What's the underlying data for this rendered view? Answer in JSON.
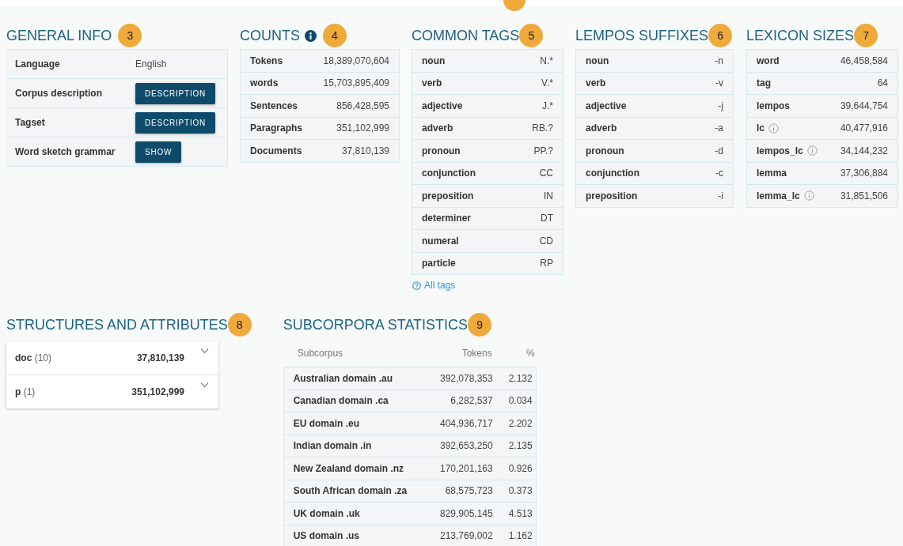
{
  "general_info": {
    "title": "GENERAL INFO",
    "badge": "3",
    "rows": [
      {
        "label": "Language",
        "kind": "text",
        "value": "English"
      },
      {
        "label": "Corpus description",
        "kind": "button",
        "value": "DESCRIPTION"
      },
      {
        "label": "Tagset",
        "kind": "button",
        "value": "DESCRIPTION"
      },
      {
        "label": "Word sketch grammar",
        "kind": "button",
        "value": "SHOW"
      }
    ]
  },
  "counts": {
    "title": "COUNTS",
    "badge": "4",
    "info": true,
    "rows": [
      {
        "label": "Tokens",
        "value": "18,389,070,604"
      },
      {
        "label": "words",
        "value": "15,703,895,409"
      },
      {
        "label": "Sentences",
        "value": "856,428,595"
      },
      {
        "label": "Paragraphs",
        "value": "351,102,999"
      },
      {
        "label": "Documents",
        "value": "37,810,139"
      }
    ]
  },
  "common_tags": {
    "title": "COMMON TAGS",
    "badge": "5",
    "rows": [
      {
        "label": "noun",
        "value": "N.*"
      },
      {
        "label": "verb",
        "value": "V.*"
      },
      {
        "label": "adjective",
        "value": "J.*"
      },
      {
        "label": "adverb",
        "value": "RB.?"
      },
      {
        "label": "pronoun",
        "value": "PP.?"
      },
      {
        "label": "conjunction",
        "value": "CC"
      },
      {
        "label": "preposition",
        "value": "IN"
      },
      {
        "label": "determiner",
        "value": "DT"
      },
      {
        "label": "numeral",
        "value": "CD"
      },
      {
        "label": "particle",
        "value": "RP"
      }
    ],
    "link": "All tags"
  },
  "lempos_suffixes": {
    "title": "LEMPOS SUFFIXES",
    "badge": "6",
    "rows": [
      {
        "label": "noun",
        "value": "-n"
      },
      {
        "label": "verb",
        "value": "-v"
      },
      {
        "label": "adjective",
        "value": "-j"
      },
      {
        "label": "adverb",
        "value": "-a"
      },
      {
        "label": "pronoun",
        "value": "-d"
      },
      {
        "label": "conjunction",
        "value": "-c"
      },
      {
        "label": "preposition",
        "value": "-i"
      }
    ]
  },
  "lexicon_sizes": {
    "title": "LEXICON SIZES",
    "badge": "7",
    "rows": [
      {
        "label": "word",
        "value": "46,458,584",
        "info": false
      },
      {
        "label": "tag",
        "value": "64",
        "info": false
      },
      {
        "label": "lempos",
        "value": "39,644,754",
        "info": false
      },
      {
        "label": "lc",
        "value": "40,477,916",
        "info": true
      },
      {
        "label": "lempos_lc",
        "value": "34,144,232",
        "info": true
      },
      {
        "label": "lemma",
        "value": "37,306,884",
        "info": false
      },
      {
        "label": "lemma_lc",
        "value": "31,851,506",
        "info": true
      }
    ]
  },
  "structures": {
    "title": "STRUCTURES AND ATTRIBUTES",
    "badge": "8",
    "rows": [
      {
        "name": "doc",
        "count": "(10)",
        "total": "37,810,139",
        "expanded": false
      },
      {
        "name": "p",
        "count": "(1)",
        "total": "351,102,999",
        "expanded": false
      }
    ]
  },
  "subcorpora": {
    "title": "SUBCORPORA STATISTICS",
    "badge": "9",
    "columns": [
      "Subcorpus",
      "Tokens",
      "%"
    ],
    "rows": [
      [
        "Australian domain .au",
        "392,078,353",
        "2.132"
      ],
      [
        "Canadian domain .ca",
        "6,282,537",
        "0.034"
      ],
      [
        "EU domain .eu",
        "404,936,717",
        "2.202"
      ],
      [
        "Indian domain .in",
        "392,653,250",
        "2.135"
      ],
      [
        "New Zealand domain .nz",
        "170,201,163",
        "0.926"
      ],
      [
        "South African domain .za",
        "68,575,723",
        "0.373"
      ],
      [
        "UK domain .uk",
        "829,905,145",
        "4.513"
      ],
      [
        "US domain .us",
        "213,769,002",
        "1.162"
      ]
    ]
  }
}
